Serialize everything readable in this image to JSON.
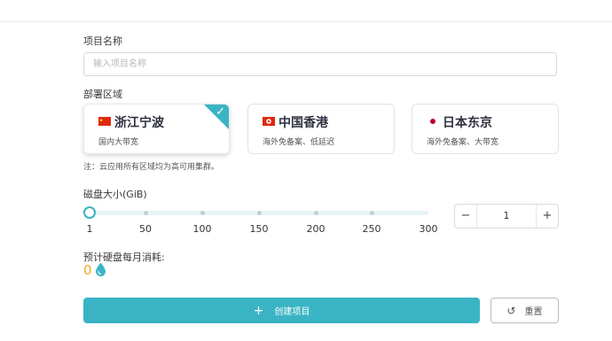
{
  "project": {
    "label": "项目名称",
    "placeholder": "输入项目名称"
  },
  "region": {
    "label": "部署区域",
    "cards": [
      {
        "title": "浙江宁波",
        "subtitle": "国内大带宽",
        "selected": true,
        "flag": "china-flag-icon"
      },
      {
        "title": "中国香港",
        "subtitle": "海外免备案、低延迟",
        "selected": false,
        "flag": "hongkong-flag-icon"
      },
      {
        "title": "日本东京",
        "subtitle": "海外免备案、大带宽",
        "selected": false,
        "flag": "japan-flag-icon"
      }
    ],
    "note": "注：云应用所有区域均为高可用集群。"
  },
  "disk": {
    "label": "磁盘大小(GiB)",
    "ticks": [
      "1",
      "50",
      "100",
      "150",
      "200",
      "250",
      "300"
    ],
    "min": 1,
    "max": 300,
    "value": 1,
    "stepper": {
      "minus": "−",
      "value": "1",
      "plus": "+"
    }
  },
  "cost": {
    "label": "预计硬盘每月消耗:",
    "value": "0",
    "icon": "water-drop-icon"
  },
  "actions": {
    "create_label": "创建项目",
    "create_icon": "+",
    "reset_label": "重置",
    "reset_icon": "↺"
  },
  "colors": {
    "accent": "#3ab4c4",
    "cost": "#f5a623"
  }
}
